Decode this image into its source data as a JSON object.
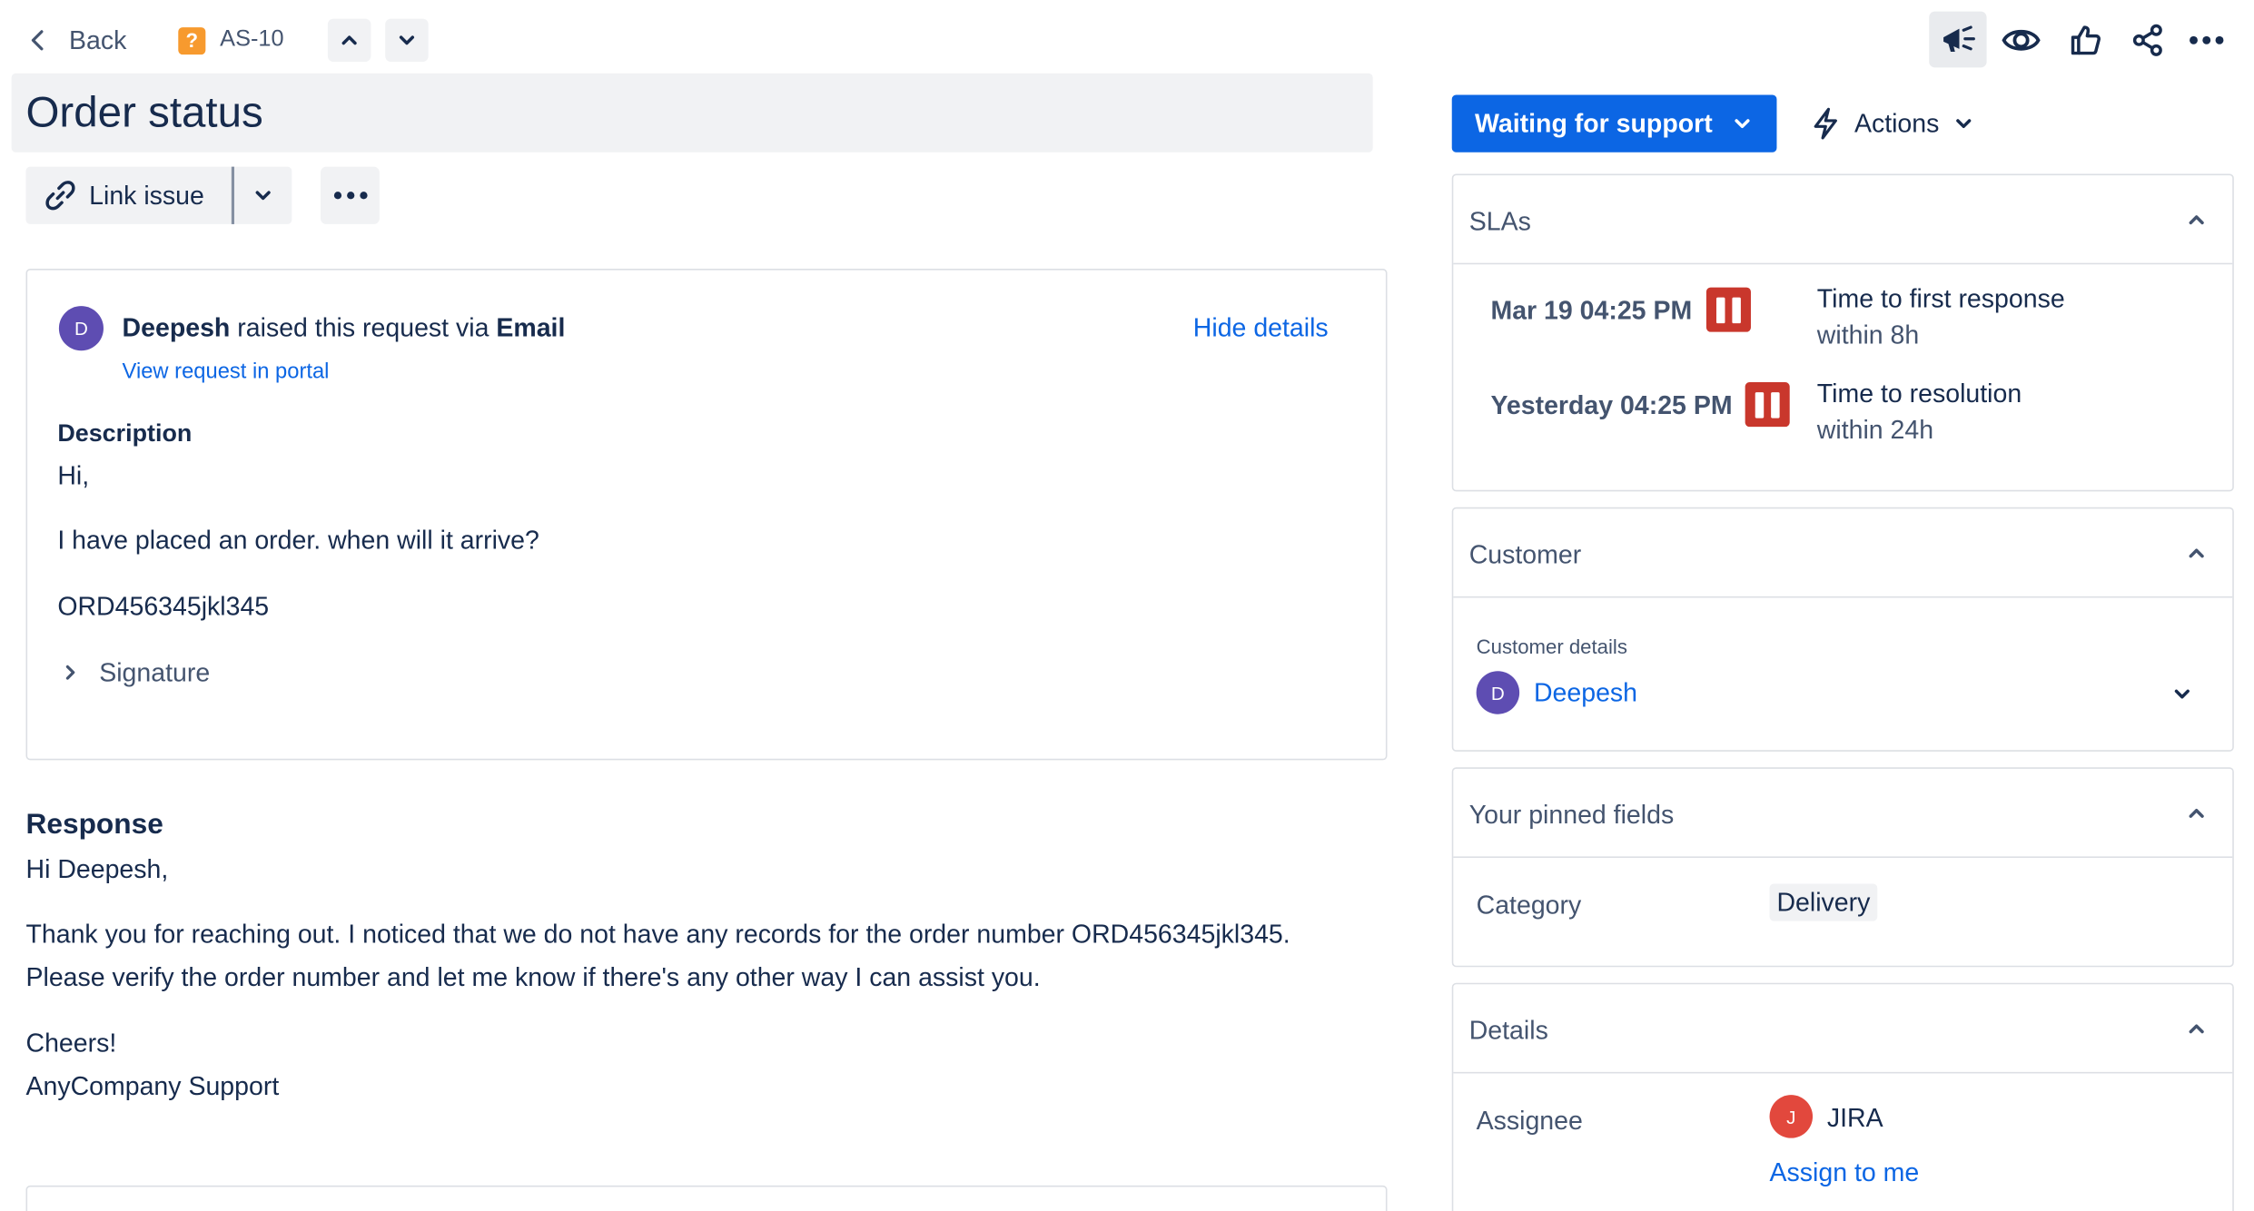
{
  "header": {
    "back_label": "Back",
    "issue_key": "AS-10",
    "issue_type_glyph": "?",
    "title": "Order status"
  },
  "toolbar": {
    "link_issue_label": "Link issue"
  },
  "request": {
    "reporter": "Deepesh",
    "reporter_initial": "D",
    "raised_text": "raised this request via",
    "channel": "Email",
    "hide_details_label": "Hide details",
    "portal_link_label": "View request in portal",
    "description_heading": "Description",
    "description_lines": [
      "Hi,",
      "I have placed an order. when will it arrive?",
      "ORD456345jkl345"
    ],
    "signature_label": "Signature"
  },
  "response": {
    "heading": "Response",
    "greeting": "Hi Deepesh,",
    "line1": "Thank you for reaching out. I noticed that we do not have any records for the order number ORD456345jkl345.",
    "line2": "Please verify the order number and let me know if there's any other way I can assist you.",
    "signoff": "Cheers!",
    "signature": "AnyCompany Support"
  },
  "status": {
    "label": "Waiting for support",
    "actions_label": "Actions",
    "status_color": "#0c66e4"
  },
  "slas": {
    "title": "SLAs",
    "items": [
      {
        "time": "Mar 19 04:25 PM",
        "name": "Time to first response",
        "goal": "within 8h"
      },
      {
        "time": "Yesterday 04:25 PM",
        "name": "Time to resolution",
        "goal": "within 24h"
      }
    ],
    "paused_color": "#c9372c"
  },
  "customer": {
    "title": "Customer",
    "details_label": "Customer details",
    "name": "Deepesh",
    "initial": "D"
  },
  "pinned": {
    "title": "Your pinned fields",
    "field_label": "Category",
    "field_value": "Delivery"
  },
  "details": {
    "title": "Details",
    "assignee_label": "Assignee",
    "assignee_name": "JIRA",
    "assignee_initial": "J",
    "assign_to_me_label": "Assign to me"
  },
  "colors": {
    "avatar_purple": "#5e4db2",
    "avatar_orange": "#e2483d",
    "issue_type_orange": "#f79a2e"
  }
}
